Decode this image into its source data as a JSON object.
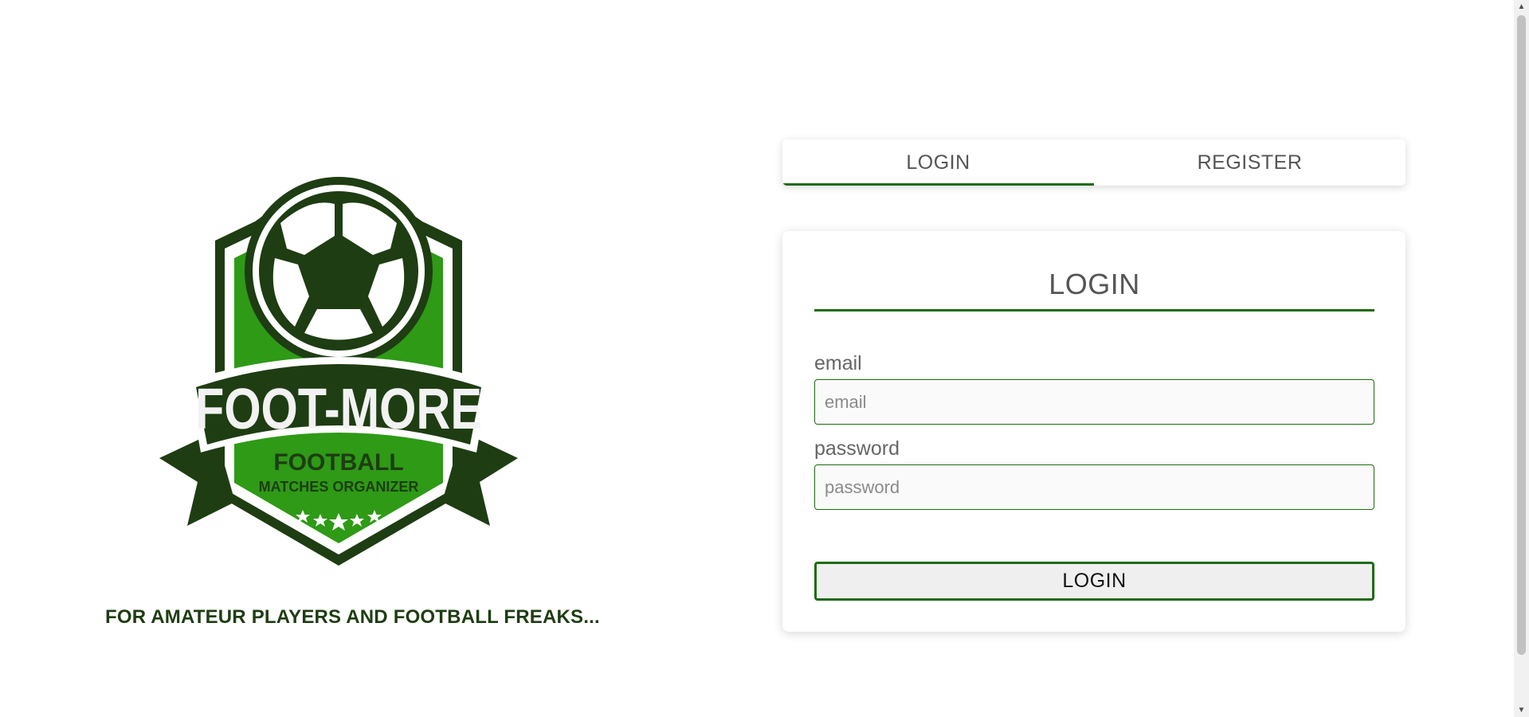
{
  "brand": {
    "logo_text": "FOOT-MORE",
    "logo_subtitle_1": "FOOTBALL",
    "logo_subtitle_2": "MATCHES ORGANIZER",
    "tagline": "FOR AMATEUR PLAYERS AND FOOTBALL FREAKS...",
    "colors": {
      "dark_green": "#1e3d12",
      "bright_green": "#2e9a16",
      "accent": "#1e6b12"
    }
  },
  "tabs": [
    {
      "label": "LOGIN",
      "active": true
    },
    {
      "label": "REGISTER",
      "active": false
    }
  ],
  "login_form": {
    "title": "LOGIN",
    "email_label": "email",
    "email_placeholder": "email",
    "email_value": "",
    "password_label": "password",
    "password_placeholder": "password",
    "password_value": "",
    "submit_label": "LOGIN"
  },
  "scrollbar": {
    "up_icon": "arrow-up-icon",
    "down_icon": "arrow-down-icon"
  }
}
